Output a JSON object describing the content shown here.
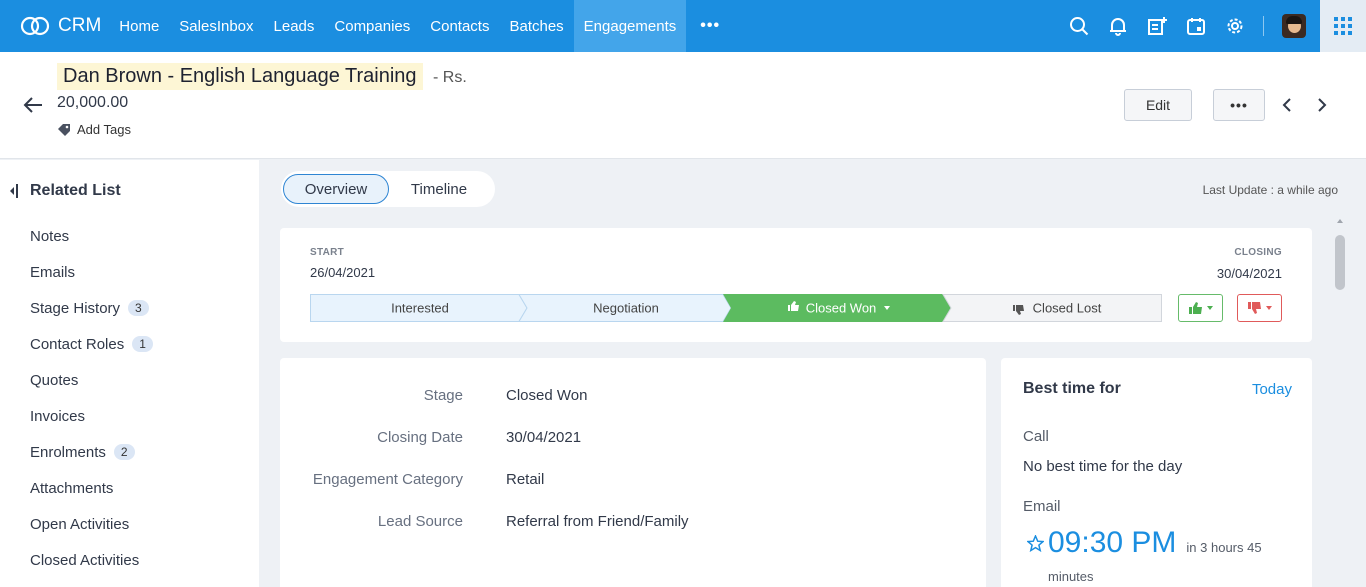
{
  "app": {
    "name": "CRM"
  },
  "nav": {
    "items": [
      {
        "label": "Home"
      },
      {
        "label": "SalesInbox"
      },
      {
        "label": "Leads"
      },
      {
        "label": "Companies"
      },
      {
        "label": "Contacts"
      },
      {
        "label": "Batches"
      },
      {
        "label": "Engagements",
        "active": true
      }
    ],
    "more_label": "•••"
  },
  "icons": [
    "search-icon",
    "bell-icon",
    "add-note-icon",
    "calendar-icon",
    "gear-icon",
    "avatar",
    "apps-grid-icon"
  ],
  "record": {
    "title": "Dan Brown - English Language Training",
    "amount_prefix": "- Rs.",
    "amount": "20,000.00",
    "add_tags": "Add Tags"
  },
  "actions": {
    "edit": "Edit",
    "more": "•••"
  },
  "sidebar": {
    "title": "Related List",
    "items": [
      {
        "label": "Notes",
        "count": ""
      },
      {
        "label": "Emails",
        "count": ""
      },
      {
        "label": "Stage History",
        "count": "3"
      },
      {
        "label": "Contact Roles",
        "count": "1"
      },
      {
        "label": "Quotes",
        "count": ""
      },
      {
        "label": "Invoices",
        "count": ""
      },
      {
        "label": "Enrolments",
        "count": "2"
      },
      {
        "label": "Attachments",
        "count": ""
      },
      {
        "label": "Open Activities",
        "count": ""
      },
      {
        "label": "Closed Activities",
        "count": ""
      }
    ]
  },
  "tabs": {
    "overview": "Overview",
    "timeline": "Timeline"
  },
  "last_update": "Last Update : a while ago",
  "stage_bar": {
    "start_label": "START",
    "start_date": "26/04/2021",
    "closing_label": "CLOSING",
    "closing_date": "30/04/2021",
    "stages": [
      "Interested",
      "Negotiation",
      "Closed Won",
      "Closed Lost"
    ],
    "current": "Closed Won",
    "colors": {
      "done": "#e8f3fd",
      "current": "#5cbb60",
      "pending": "#f3f4f6"
    }
  },
  "details": [
    {
      "key": "Stage",
      "value": "Closed Won"
    },
    {
      "key": "Closing Date",
      "value": "30/04/2021"
    },
    {
      "key": "Engagement Category",
      "value": "Retail"
    },
    {
      "key": "Lead Source",
      "value": "Referral from Friend/Family"
    }
  ],
  "best_time": {
    "title": "Best time for",
    "today": "Today",
    "call_label": "Call",
    "call_text": "No best time for the day",
    "email_label": "Email",
    "email_time": "09:30 PM",
    "email_in": "in 3 hours 45",
    "email_minutes": "minutes"
  }
}
